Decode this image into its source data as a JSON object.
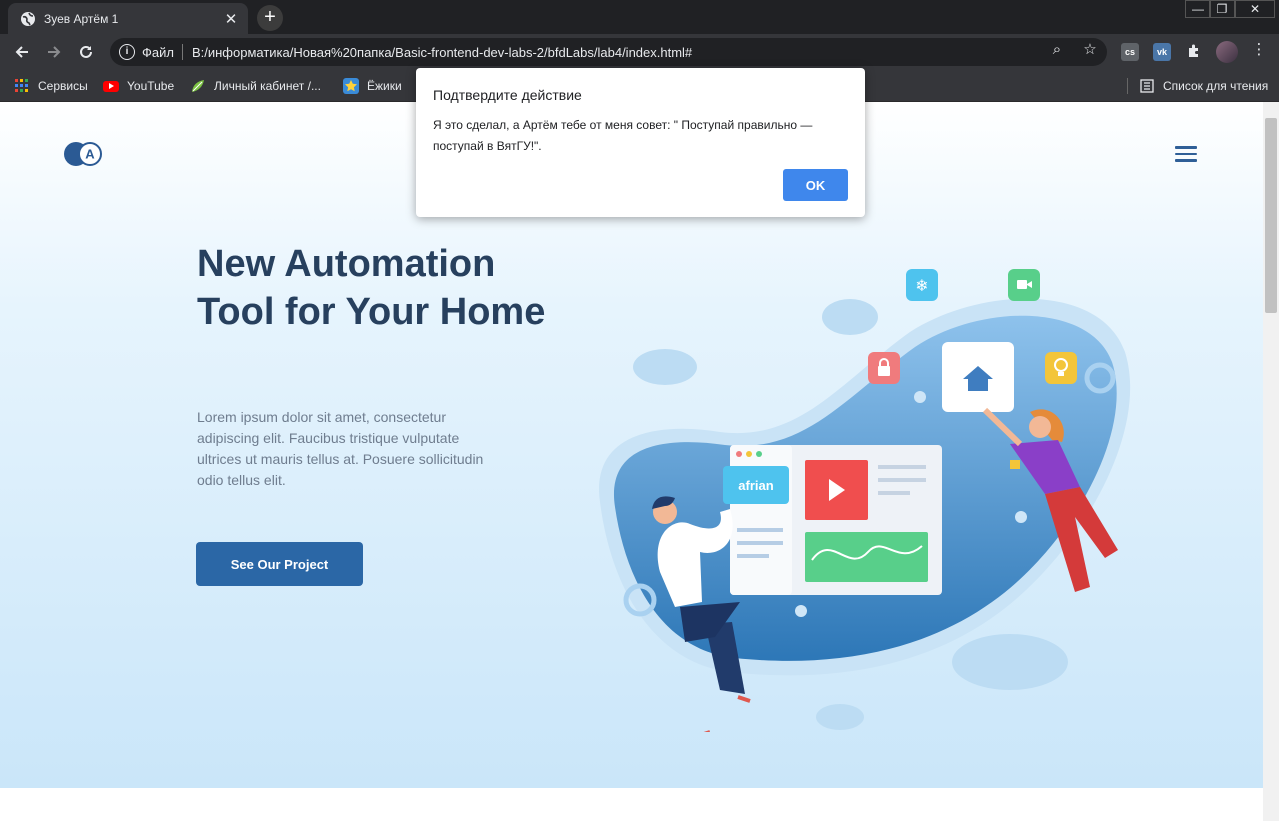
{
  "browser": {
    "tab_title": "Зуев Артём 1",
    "tab_close": "✕",
    "new_tab": "+",
    "win_min": "—",
    "win_max": "❐",
    "win_close": "✕",
    "scheme_label": "Файл",
    "url": "B:/информатика/Новая%20папка/Basic-frontend-dev-labs-2/bfdLabs/lab4/index.html#",
    "info_glyph": "i",
    "star_glyph": "☆",
    "zoom_glyph": "⌕",
    "ext_cs": "cs",
    "ext_vk": "vk",
    "menu_glyph": "⋮",
    "bookmarks": [
      {
        "label": "Сервисы"
      },
      {
        "label": "YouTube"
      },
      {
        "label": "Личный кабинет /..."
      },
      {
        "label": "Ёжики"
      }
    ],
    "reading_list": "Список для чтения"
  },
  "page": {
    "logo_letter": "A",
    "headline": "New Automation Tool for Your Home",
    "lead": "Lorem ipsum dolor sit amet, consectetur adipiscing elit. Faucibus tristique vulputate ultrices ut mauris tellus at. Posuere sollicitudin odio tellus elit.",
    "cta_label": "See Our Project",
    "illustration_brand": "afrian"
  },
  "dialog": {
    "title": "Подтвердите действие",
    "message": "Я это сделал, а Артём тебе от меня совет: \" Поступай правильно — поступай в ВятГУ!\".",
    "ok_label": "OK"
  },
  "colors": {
    "chrome_dark": "#202124",
    "chrome_mid": "#35363a",
    "headline": "#27405e",
    "button_blue": "#2b67a6",
    "dialog_ok": "#3f87ec"
  }
}
